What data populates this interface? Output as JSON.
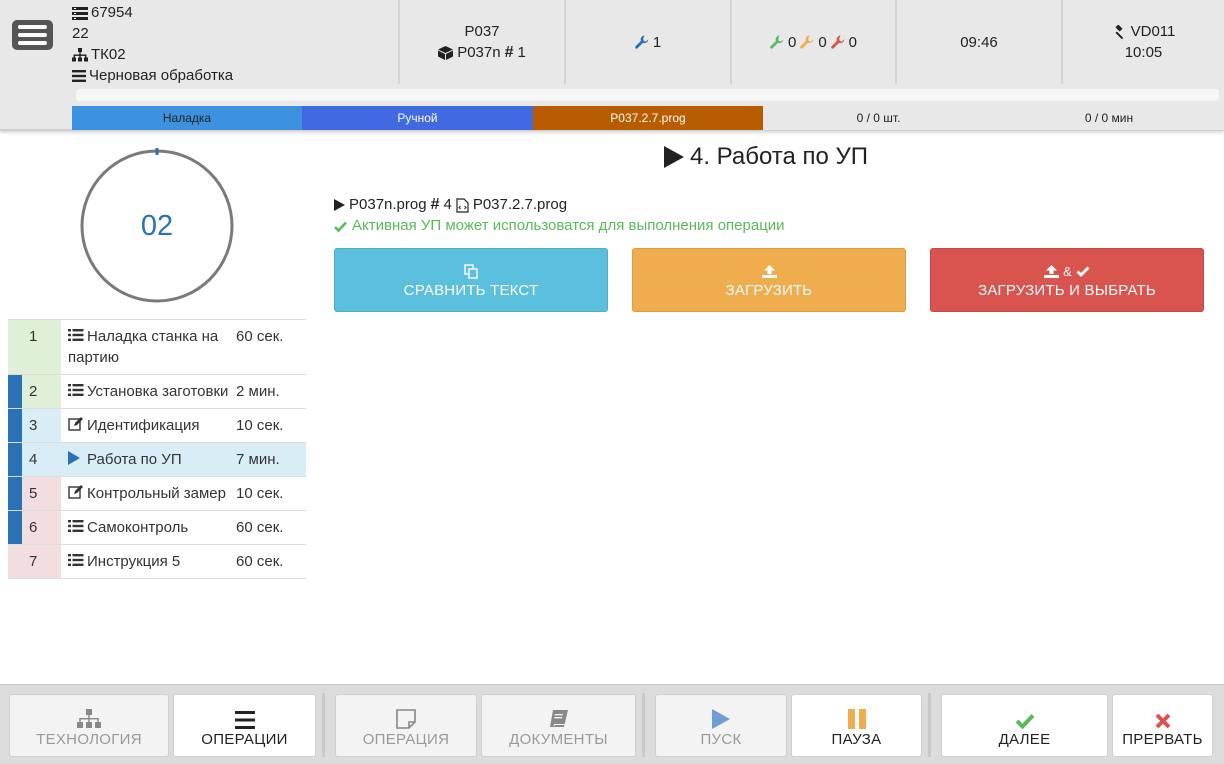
{
  "header": {
    "order_id": "67954",
    "quantity": "22",
    "workcenter": "ТК02",
    "operation_name": "Черновая обработка",
    "part": "P037",
    "program": "P037n",
    "program_hash": "1",
    "tools_count": "1",
    "tool_status": [
      "0",
      "0",
      "0"
    ],
    "time_now": "09:46",
    "operator": "VD011",
    "operator_time": "10:05"
  },
  "status_bar": {
    "mode": "Наладка",
    "control": "Ручной",
    "program_file": "P037.2.7.prog",
    "pieces": "0 / 0 шт.",
    "minutes": "0 / 0 мин"
  },
  "colors": {
    "mode": "#3d92e0",
    "control": "#4169e1",
    "program": "#b85c00",
    "green_row": "#dff0d8",
    "blue_row": "#d9edf7",
    "red_row": "#f2dede",
    "active_flag": "#2b71b5"
  },
  "cycle_dial": {
    "value": "02"
  },
  "operations": [
    {
      "num": "1",
      "icon": "list-icon",
      "name": "Наладка станка на партию",
      "time": "60 сек.",
      "state": "green",
      "flag": false
    },
    {
      "num": "2",
      "icon": "list-icon",
      "name": "Установка заготовки",
      "time": "2 мин.",
      "state": "green",
      "flag": true
    },
    {
      "num": "3",
      "icon": "edit-icon",
      "name": "Идентификация",
      "time": "10 сек.",
      "state": "blue",
      "flag": true
    },
    {
      "num": "4",
      "icon": "play-icon",
      "name": "Работа по УП",
      "time": "7 мин.",
      "state": "active",
      "flag": true
    },
    {
      "num": "5",
      "icon": "edit-icon",
      "name": "Контрольный замер",
      "time": "10 сек.",
      "state": "red",
      "flag": true
    },
    {
      "num": "6",
      "icon": "list-icon",
      "name": "Самоконтроль",
      "time": "60 сек.",
      "state": "red",
      "flag": true
    },
    {
      "num": "7",
      "icon": "list-icon",
      "name": "Инструкция 5",
      "time": "60 сек.",
      "state": "red",
      "flag": false
    }
  ],
  "main": {
    "step_title": "4. Работа по УП",
    "program_name": "P037n.prog",
    "program_hash": "4",
    "program_file": "P037.2.7.prog",
    "active_message": "Активная УП может использоватся для выполнения операции",
    "compare_label": "СРАВНИТЬ ТЕКСТ",
    "upload_label": "ЗАГРУЗИТЬ",
    "upload_select_label": "ЗАГРУЗИТЬ И ВЫБРАТЬ",
    "upload_select_amp": "&"
  },
  "toolbar": {
    "technology": "ТЕХНОЛОГИЯ",
    "operations": "ОПЕРАЦИИ",
    "operation": "ОПЕРАЦИЯ",
    "documents": "ДОКУМЕНТЫ",
    "start": "ПУСК",
    "pause": "ПАУЗА",
    "next": "ДАЛЕЕ",
    "abort": "ПРЕРВАТЬ"
  }
}
